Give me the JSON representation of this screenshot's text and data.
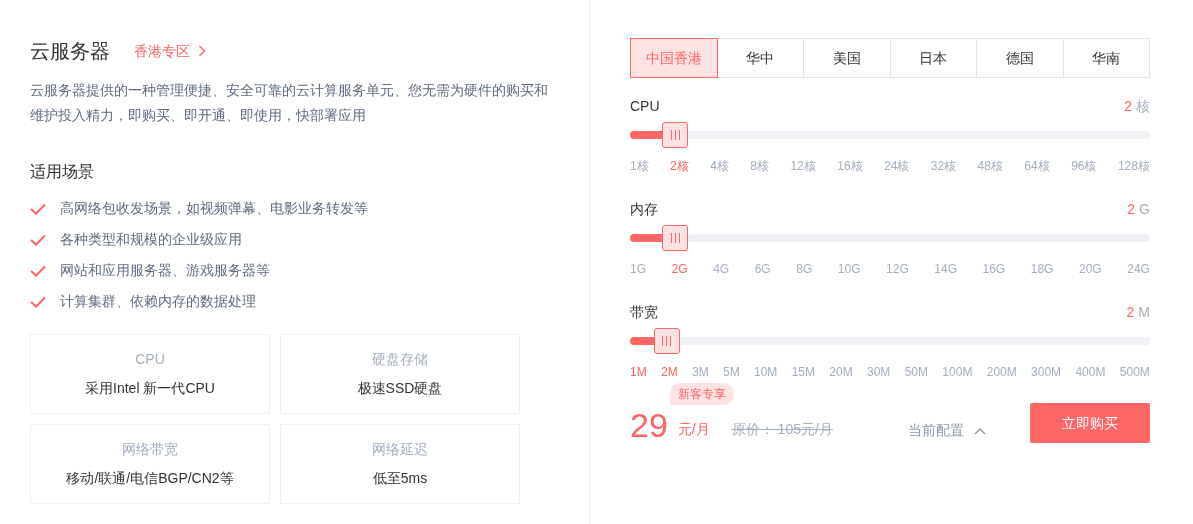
{
  "title": "云服务器",
  "zone_link": "香港专区",
  "description": "云服务器提供的一种管理便捷、安全可靠的云计算服务单元、您无需为硬件的购买和维护投入精力，即购买、即开通、即使用，快部署应用",
  "scenarios_title": "适用场景",
  "scenarios": [
    "高网络包收发场景，如视频弹幕、电影业务转发等",
    "各种类型和规模的企业级应用",
    "网站和应用服务器、游戏服务器等",
    "计算集群、依赖内存的数据处理"
  ],
  "features": [
    {
      "title": "CPU",
      "text": "采用Intel 新一代CPU"
    },
    {
      "title": "硬盘存储",
      "text": "极速SSD硬盘"
    },
    {
      "title": "网络带宽",
      "text": "移动/联通/电信BGP/CN2等"
    },
    {
      "title": "网络延迟",
      "text": "低至5ms"
    }
  ],
  "regions": [
    {
      "label": "中国香港",
      "selected": true
    },
    {
      "label": "华中",
      "selected": false
    },
    {
      "label": "美国",
      "selected": false
    },
    {
      "label": "日本",
      "selected": false
    },
    {
      "label": "德国",
      "selected": false
    },
    {
      "label": "华南",
      "selected": false
    }
  ],
  "sliders": [
    {
      "label": "CPU",
      "value": "2",
      "unit": "核",
      "level": 0.087,
      "ticks": [
        {
          "label": "1核",
          "highlighted": false
        },
        {
          "label": "2核",
          "highlighted": true
        },
        {
          "label": "4核",
          "highlighted": false
        },
        {
          "label": "8核",
          "highlighted": false
        },
        {
          "label": "12核",
          "highlighted": false
        },
        {
          "label": "16核",
          "highlighted": false
        },
        {
          "label": "24核",
          "highlighted": false
        },
        {
          "label": "32核",
          "highlighted": false
        },
        {
          "label": "48核",
          "highlighted": false
        },
        {
          "label": "64核",
          "highlighted": false
        },
        {
          "label": "96核",
          "highlighted": false
        },
        {
          "label": "128核",
          "highlighted": false
        }
      ]
    },
    {
      "label": "内存",
      "value": "2",
      "unit": "G",
      "level": 0.087,
      "ticks": [
        {
          "label": "1G",
          "highlighted": false
        },
        {
          "label": "2G",
          "highlighted": true
        },
        {
          "label": "4G",
          "highlighted": false
        },
        {
          "label": "6G",
          "highlighted": false
        },
        {
          "label": "8G",
          "highlighted": false
        },
        {
          "label": "10G",
          "highlighted": false
        },
        {
          "label": "12G",
          "highlighted": false
        },
        {
          "label": "14G",
          "highlighted": false
        },
        {
          "label": "16G",
          "highlighted": false
        },
        {
          "label": "18G",
          "highlighted": false
        },
        {
          "label": "20G",
          "highlighted": false
        },
        {
          "label": "24G",
          "highlighted": false
        }
      ]
    },
    {
      "label": "带宽",
      "value": "2",
      "unit": "M",
      "level": 0.071,
      "ticks": [
        {
          "label": "1M",
          "highlighted": true
        },
        {
          "label": "2M",
          "highlighted": true
        },
        {
          "label": "3M",
          "highlighted": false
        },
        {
          "label": "5M",
          "highlighted": false
        },
        {
          "label": "10M",
          "highlighted": false
        },
        {
          "label": "15M",
          "highlighted": false
        },
        {
          "label": "20M",
          "highlighted": false
        },
        {
          "label": "30M",
          "highlighted": false
        },
        {
          "label": "50M",
          "highlighted": false
        },
        {
          "label": "100M",
          "highlighted": false
        },
        {
          "label": "200M",
          "highlighted": false
        },
        {
          "label": "300M",
          "highlighted": false
        },
        {
          "label": "400M",
          "highlighted": false
        },
        {
          "label": "500M",
          "highlighted": false
        }
      ]
    }
  ],
  "promo_badge": "新客专享",
  "price": "29",
  "price_unit": "元/月",
  "original_price": "原价： 105元/月",
  "config_toggle": "当前配置",
  "buy_button": "立即购买"
}
